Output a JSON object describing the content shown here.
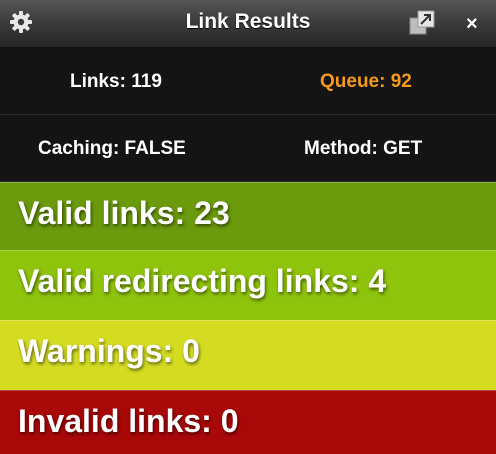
{
  "window": {
    "title": "Link Results",
    "icons": {
      "settings": "gear-icon",
      "popout": "popout-icon",
      "close": "close-icon"
    },
    "close_glyph": "×"
  },
  "stats": {
    "links": "Links: 119",
    "queue": "Queue: 92",
    "caching": "Caching: FALSE",
    "method": "Method: GET"
  },
  "results": {
    "valid": "Valid links: 23",
    "redirecting": "Valid redirecting links: 4",
    "warnings": "Warnings: 0",
    "invalid": "Invalid links: 0"
  },
  "colors": {
    "queue_text": "#f59a1e",
    "valid": "#6b9a0c",
    "redirecting": "#8fc40c",
    "warnings": "#d4dc22",
    "invalid": "#a80808"
  }
}
